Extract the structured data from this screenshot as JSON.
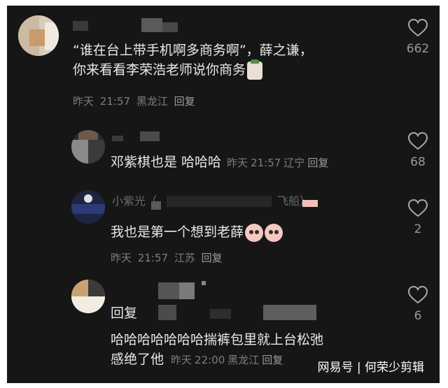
{
  "comments": [
    {
      "username": "",
      "lines": [
        "“谁在台上带手机啊多商务啊”，薛之谦，",
        "你来看看李荣浩老师说你商务"
      ],
      "time_prefix": "昨天",
      "time": "21:57",
      "location": "黑龙江",
      "reply": "回复",
      "likes": "662"
    },
    {
      "username": "",
      "lines": [
        "邓紫棋也是 哈哈哈"
      ],
      "time_prefix": "昨天",
      "time": "21:57",
      "location": "辽宁",
      "reply": "回复",
      "likes": "68"
    },
    {
      "username": "小紫光（",
      "username_tail": "飞船）",
      "lines": [
        "我也是第一个想到老薛"
      ],
      "time_prefix": "昨天",
      "time": "21:57",
      "location": "江苏",
      "reply": "回复",
      "likes": "2"
    },
    {
      "username": "",
      "reply_prefix": "回复",
      "lines": [
        "哈哈哈哈哈哈哈揣裤包里就上台松弛",
        "感绝了他"
      ],
      "time_prefix": "昨天",
      "time": "22:00",
      "location": "黑龙江",
      "reply": "回复",
      "likes": "6"
    }
  ],
  "watermark": "网易号 | 何荣少剪辑",
  "icons": {
    "like": "heart-outline-icon",
    "emoji": "pink-face-emoji-icon",
    "sticker": "sticker-icon"
  },
  "colors": {
    "background": "#161616",
    "text": "#e8e8e8",
    "meta": "#7d7d7d"
  }
}
